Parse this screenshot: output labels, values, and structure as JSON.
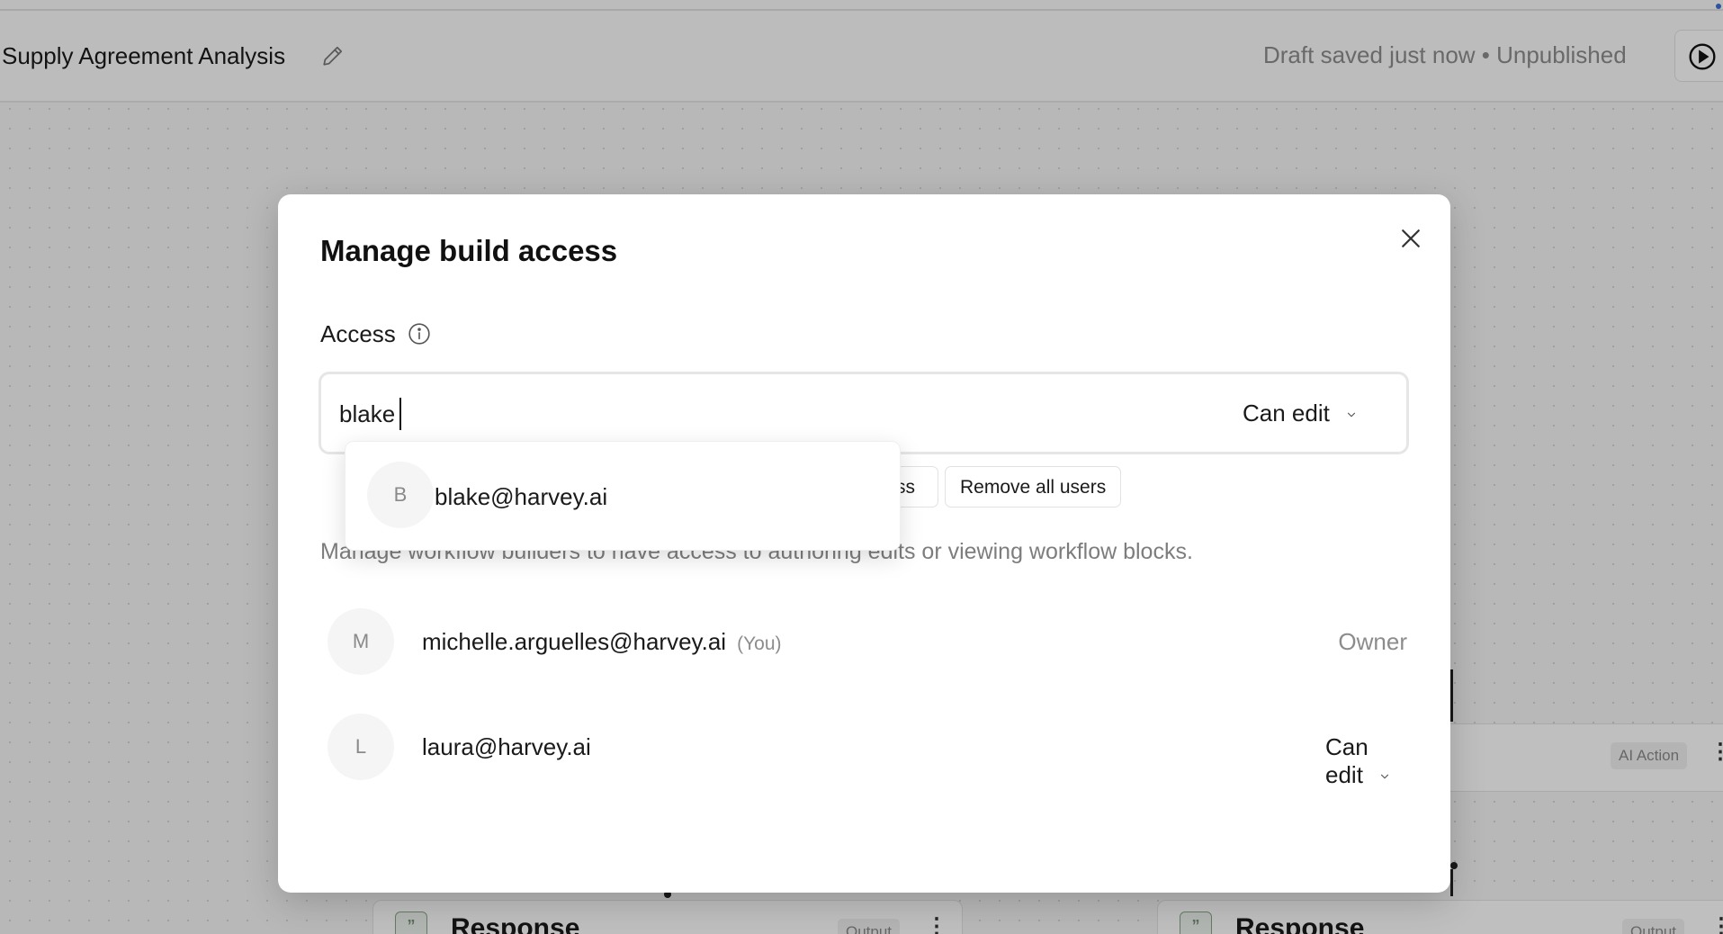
{
  "header": {
    "doc_title": "Supply Agreement Analysis",
    "status": "Draft saved just now • Unpublished"
  },
  "background": {
    "cards": [
      {
        "title": "Response",
        "tag": "Output"
      },
      {
        "title": "Response",
        "tag": "Output"
      }
    ],
    "side_tag": "AI Action"
  },
  "modal": {
    "title": "Manage build access",
    "access_label": "Access",
    "search": {
      "value": "blake",
      "permission": "Can edit"
    },
    "buttons": {
      "partial": "ss",
      "remove_all": "Remove all users"
    },
    "help_text": "Manage workflow builders to have access to authoring edits or viewing workflow blocks.",
    "users": [
      {
        "initial": "M",
        "email": "michelle.arguelles@harvey.ai",
        "tag": "(You)",
        "role": "Owner"
      },
      {
        "initial": "L",
        "email": "laura@harvey.ai",
        "role": "Can edit"
      }
    ]
  },
  "dropdown": {
    "suggestions": [
      {
        "initial": "B",
        "email": "blake@harvey.ai"
      }
    ]
  },
  "icons": {
    "edit": "pencil-icon",
    "play": "play-circle-icon",
    "close": "close-icon",
    "info": "info-icon",
    "chevron": "chevron-down-icon",
    "response": "quote-icon"
  },
  "colors": {
    "overlay": "#000000",
    "status_text": "#8c8c8c",
    "accent_dot": "#3b6fd4"
  }
}
